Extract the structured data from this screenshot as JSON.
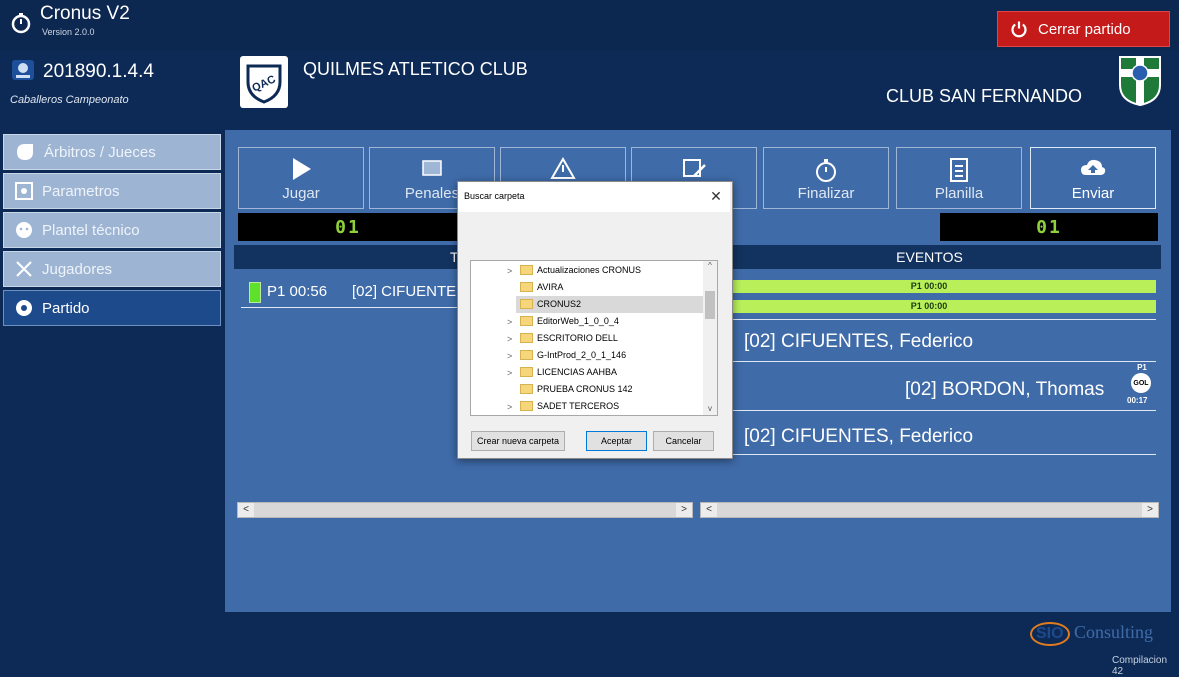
{
  "titlebar": {
    "app_name": "Cronus V2",
    "version": "Version 2.0.0",
    "close_match_label": "Cerrar partido"
  },
  "header": {
    "match_code": "201890.1.4.4",
    "category": "Caballeros Campeonato",
    "home_team": "QUILMES ATLETICO CLUB",
    "home_shield_text": "QAC",
    "away_team": "CLUB SAN FERNANDO"
  },
  "sidebar": {
    "items": [
      {
        "label": "Árbitros / Jueces",
        "icon": "referee-icon",
        "active": false
      },
      {
        "label": "Parametros",
        "icon": "settings-icon",
        "active": false
      },
      {
        "label": "Plantel técnico",
        "icon": "staff-icon",
        "active": false
      },
      {
        "label": "Jugadores",
        "icon": "players-icon",
        "active": false
      },
      {
        "label": "Partido",
        "icon": "ball-icon",
        "active": true
      }
    ]
  },
  "toolbar": {
    "buttons": [
      {
        "label": "Jugar",
        "icon": "play-icon"
      },
      {
        "label": "Penales",
        "icon": "penalty-icon"
      },
      {
        "label": "",
        "icon": "warning-icon"
      },
      {
        "label": "",
        "icon": "edit-icon"
      },
      {
        "label": "Finalizar",
        "icon": "stopwatch-icon"
      },
      {
        "label": "Planilla",
        "icon": "sheet-icon"
      },
      {
        "label": "Enviar",
        "icon": "cloud-upload-icon"
      }
    ]
  },
  "score": {
    "home": "01",
    "away": "01"
  },
  "left_panel": {
    "header": "TAR",
    "entry_time": "P1 00:56",
    "entry_text": "[02] CIFUENTE"
  },
  "right_panel": {
    "header": "EVENTOS",
    "period_markers": [
      "P1 00:00",
      "P1 00:00"
    ],
    "events": [
      {
        "text": "[02] CIFUENTES, Federico"
      },
      {
        "text": "[02] BORDON, Thomas",
        "badge_period": "P1",
        "badge_type": "GOL",
        "badge_time": "00:17"
      },
      {
        "text": "[02] CIFUENTES, Federico"
      }
    ]
  },
  "dialog": {
    "title": "Buscar carpeta",
    "folders": [
      {
        "label": "Actualizaciones CRONUS",
        "expandable": true,
        "selected": false
      },
      {
        "label": "AVIRA",
        "expandable": false,
        "selected": false
      },
      {
        "label": "CRONUS2",
        "expandable": false,
        "selected": true
      },
      {
        "label": "EditorWeb_1_0_0_4",
        "expandable": true,
        "selected": false
      },
      {
        "label": "ESCRITORIO DELL",
        "expandable": true,
        "selected": false
      },
      {
        "label": "G-IntProd_2_0_1_146",
        "expandable": true,
        "selected": false
      },
      {
        "label": "LICENCIAS AAHBA",
        "expandable": true,
        "selected": false
      },
      {
        "label": "PRUEBA CRONUS 142",
        "expandable": false,
        "selected": false
      },
      {
        "label": "SADET TERCEROS",
        "expandable": true,
        "selected": false
      }
    ],
    "new_folder_label": "Crear nueva carpeta",
    "accept_label": "Aceptar",
    "cancel_label": "Cancelar"
  },
  "footer": {
    "brand_logo_text": "SIO",
    "brand_name": "Consulting",
    "compilation": "Compilacion 42"
  },
  "colors": {
    "background": "#0d2a56",
    "panel": "#3f6ba9",
    "close_button": "#c41a1a",
    "score_digits": "#8fd13b",
    "period_bar": "#b9f05a"
  }
}
